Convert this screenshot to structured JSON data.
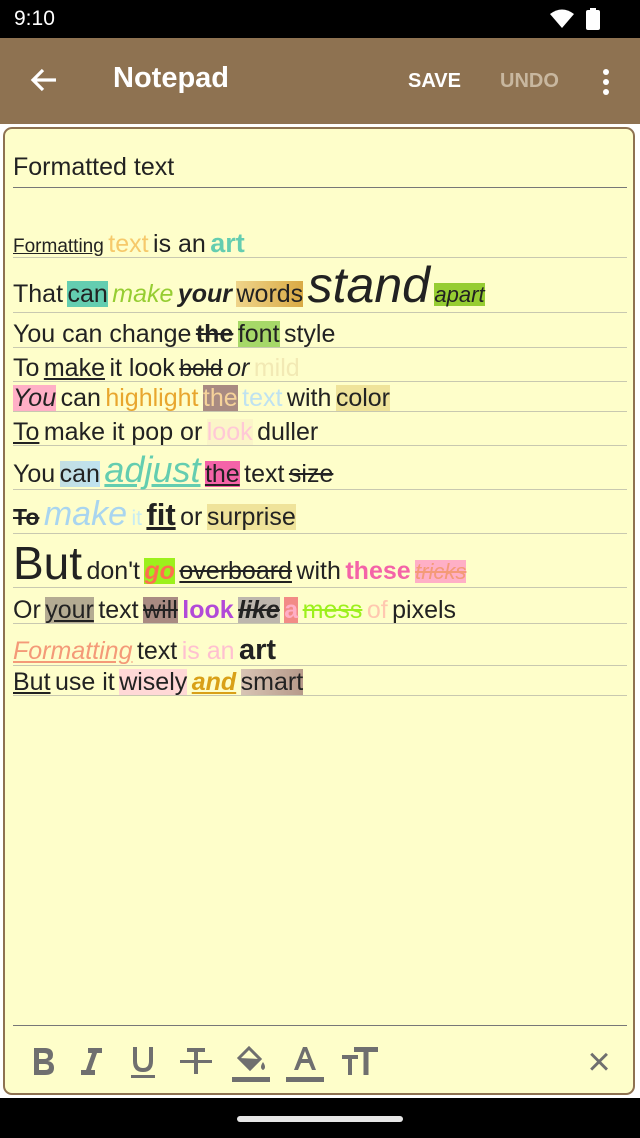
{
  "status": {
    "time": "9:10"
  },
  "app": {
    "title": "Notepad",
    "save": "SAVE",
    "undo": "UNDO"
  },
  "note": {
    "title": "Formatted text",
    "lines": [
      [
        {
          "t": "Formatting",
          "s": "font-size:19px;text-decoration:underline"
        },
        {
          "t": "text",
          "s": "font-size:25px;color:#f6c96b"
        },
        {
          "t": "is an",
          "s": "font-size:25px"
        },
        {
          "t": "art",
          "s": "font-size:27px;font-weight:bold;color:#64cdb0"
        }
      ],
      [
        {
          "t": "That",
          "s": "font-size:25px"
        },
        {
          "t": "can",
          "s": "font-size:25px;background:#64cdb0"
        },
        {
          "t": "make",
          "s": "font-size:25px;font-style:italic;color:#96cd32"
        },
        {
          "t": "your",
          "s": "font-size:25px;font-style:italic;font-weight:bold"
        },
        {
          "t": "words",
          "s": "font-size:25px;background:linear-gradient(90deg,#efd48a,#d9aa44)"
        },
        {
          "t": "stand",
          "s": "font-size:50px;font-style:italic"
        },
        {
          "t": "apart",
          "s": "font-size:22px;font-style:italic;background:#96cd32"
        }
      ],
      [
        {
          "t": "You can change",
          "s": "font-size:25px"
        },
        {
          "t": "the",
          "s": "font-size:25px;font-weight:bold;text-decoration:line-through"
        },
        {
          "t": "font",
          "s": "font-size:25px;background:#a6d868"
        },
        {
          "t": "style",
          "s": "font-size:25px"
        }
      ],
      [
        {
          "t": "To",
          "s": "font-size:25px"
        },
        {
          "t": "make",
          "s": "font-size:25px;text-decoration:underline"
        },
        {
          "t": "it look",
          "s": "font-size:25px"
        },
        {
          "t": "bold",
          "s": "font-size:23px;text-decoration:line-through"
        },
        {
          "t": "or",
          "s": "font-size:25px;font-style:italic"
        },
        {
          "t": "mild",
          "s": "font-size:25px;color:#f2e9b4"
        }
      ],
      [
        {
          "t": "You",
          "s": "font-size:25px;font-style:italic;background:#ffafc6"
        },
        {
          "t": "can",
          "s": "font-size:25px"
        },
        {
          "t": "highlight",
          "s": "font-size:25px;color:#e8a62e"
        },
        {
          "t": "the",
          "s": "font-size:25px;background:#a98b82;color:#f6d39a"
        },
        {
          "t": "text",
          "s": "font-size:25px;color:#bfe2f0"
        },
        {
          "t": "with",
          "s": "font-size:25px"
        },
        {
          "t": "color",
          "s": "font-size:25px;background:#efe39a"
        }
      ],
      [
        {
          "t": "To",
          "s": "font-size:25px;text-decoration:underline"
        },
        {
          "t": "make it pop or",
          "s": "font-size:25px"
        },
        {
          "t": "look",
          "s": "font-size:25px;color:#ffc8d6;background:#fbf5c8"
        },
        {
          "t": "duller",
          "s": "font-size:25px"
        }
      ],
      [
        {
          "t": "You",
          "s": "font-size:25px"
        },
        {
          "t": "can",
          "s": "font-size:25px;background:linear-gradient(90deg,#c3dfe2,#bfe2f0)"
        },
        {
          "t": "adjust",
          "s": "font-size:36px;font-style:italic;text-decoration:underline;color:#64cdb0"
        },
        {
          "t": "the",
          "s": "font-size:25px;text-decoration:underline;background:#f463a8"
        },
        {
          "t": "text",
          "s": "font-size:25px"
        },
        {
          "t": "size",
          "s": "font-size:25px;text-decoration:line-through"
        }
      ],
      [
        {
          "t": "To",
          "s": "font-size:23px;font-weight:bold;text-decoration:line-through"
        },
        {
          "t": "make",
          "s": "font-size:34px;font-style:italic;color:#a9d5ef"
        },
        {
          "t": "it",
          "s": "font-size:21px;color:#c8ecf2"
        },
        {
          "t": "fit",
          "s": "font-size:31px;font-weight:bold;text-decoration:underline"
        },
        {
          "t": "or",
          "s": "font-size:25px"
        },
        {
          "t": "surprise",
          "s": "font-size:25px;background:#efe39a"
        }
      ],
      [
        {
          "t": "But",
          "s": "font-size:46px"
        },
        {
          "t": "don't",
          "s": "font-size:25px"
        },
        {
          "t": "go",
          "s": "font-size:25px;font-style:italic;font-weight:bold;color:#ff6e4f;background:#9cf01c"
        },
        {
          "t": "overboard",
          "s": "font-size:25px;text-decoration:underline line-through"
        },
        {
          "t": "with",
          "s": "font-size:25px"
        },
        {
          "t": "these",
          "s": "font-size:25px;font-weight:bold;color:#f463a8"
        },
        {
          "t": "tricks",
          "s": "font-size:22px;font-style:italic;text-decoration:line-through;color:#f49a78;background:#ffafc6"
        }
      ],
      [
        {
          "t": "Or",
          "s": "font-size:25px"
        },
        {
          "t": "your",
          "s": "font-size:25px;text-decoration:underline;background:#b4ab92"
        },
        {
          "t": "text",
          "s": "font-size:25px"
        },
        {
          "t": "will",
          "s": "font-size:25px;text-decoration:line-through;background:#a98b82"
        },
        {
          "t": "look",
          "s": "font-size:25px;font-weight:bold;color:#b24ad8"
        },
        {
          "t": "like",
          "s": "font-size:25px;font-style:italic;font-weight:bold;text-decoration:line-through;background:#bdb6ad"
        },
        {
          "t": "a",
          "s": "font-size:25px;font-weight:bold;color:#ffafc6;background:#f28b86"
        },
        {
          "t": "mess",
          "s": "font-size:25px;text-decoration:line-through;color:#9cf01c"
        },
        {
          "t": "of",
          "s": "font-size:25px;color:#ffc8b0"
        },
        {
          "t": "pixels",
          "s": "font-size:25px"
        }
      ],
      [
        {
          "t": "Formatting",
          "s": "font-size:25px;font-style:italic;text-decoration:underline;color:#f49a78"
        },
        {
          "t": "text",
          "s": "font-size:25px"
        },
        {
          "t": "is an",
          "s": "font-size:25px;color:#ffc0d0"
        },
        {
          "t": "art",
          "s": "font-size:29px;font-weight:bold"
        }
      ],
      [
        {
          "t": "But",
          "s": "font-size:25px;text-decoration:underline"
        },
        {
          "t": "use it",
          "s": "font-size:25px"
        },
        {
          "t": "wisely",
          "s": "font-size:25px;background:#ffd8d6"
        },
        {
          "t": "and",
          "s": "font-size:25px;font-style:italic;font-weight:bold;text-decoration:underline;color:#d9a018"
        },
        {
          "t": "smart",
          "s": "font-size:25px;background:linear-gradient(90deg,#d8c4b4,#b69a8a)"
        }
      ]
    ]
  },
  "toolbar": {
    "buttons": [
      {
        "name": "bold-button",
        "glyph": "B"
      },
      {
        "name": "italic-button",
        "glyph": "I"
      },
      {
        "name": "underline-button",
        "glyph": "U"
      },
      {
        "name": "strikethrough-button",
        "glyph": "S"
      },
      {
        "name": "highlight-color-button",
        "glyph": "fill"
      },
      {
        "name": "text-color-button",
        "glyph": "A"
      },
      {
        "name": "text-size-button",
        "glyph": "size"
      }
    ],
    "close": "×"
  }
}
